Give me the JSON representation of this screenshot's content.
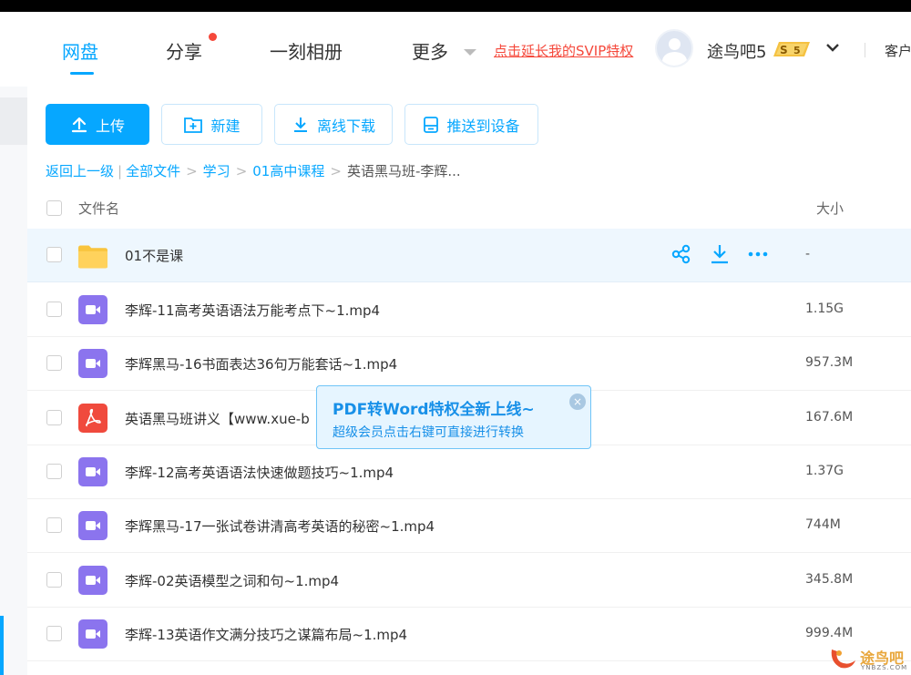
{
  "nav": {
    "items": [
      "网盘",
      "分享",
      "一刻相册",
      "更多"
    ],
    "active_index": 0,
    "svip_link": "点击延长我的SVIP特权",
    "username": "途鸟吧5",
    "svip_level": "5",
    "client_link": "客户端"
  },
  "toolbar": {
    "upload": "上传",
    "new_folder": "新建",
    "offline_download": "离线下载",
    "push_device": "推送到设备"
  },
  "breadcrumb": {
    "back": "返回上一级",
    "items": [
      "全部文件",
      "学习",
      "01高中课程"
    ],
    "current": "英语黑马班-李辉..."
  },
  "list_header": {
    "name": "文件名",
    "size": "大小"
  },
  "files": [
    {
      "name": "01不是课",
      "size": "-",
      "type": "folder"
    },
    {
      "name": "李辉-11高考英语语法万能考点下~1.mp4",
      "size": "1.15G",
      "type": "video"
    },
    {
      "name": "李辉黑马-16书面表达36句万能套话~1.mp4",
      "size": "957.3M",
      "type": "video"
    },
    {
      "name": "英语黑马班讲义【www.xue-b",
      "size": "167.6M",
      "type": "pdf"
    },
    {
      "name": "李辉-12高考英语语法快速做题技巧~1.mp4",
      "size": "1.37G",
      "type": "video"
    },
    {
      "name": "李辉黑马-17一张试卷讲清高考英语的秘密~1.mp4",
      "size": "744M",
      "type": "video"
    },
    {
      "name": "李辉-02英语模型之词和句~1.mp4",
      "size": "345.8M",
      "type": "video"
    },
    {
      "name": "李辉-13英语作文满分技巧之谋篇布局~1.mp4",
      "size": "999.4M",
      "type": "video"
    }
  ],
  "tooltip": {
    "title": "PDF转Word特权全新上线~",
    "subtitle": "超级会员点击右键可直接进行转换",
    "close": "×"
  },
  "watermark": {
    "text": "途鸟吧",
    "sub": "YNBZS.COM"
  },
  "colors": {
    "accent": "#06a7ff",
    "video": "#8b74ee",
    "pdf": "#f04a3d",
    "folder": "#ffcc4d",
    "alert": "#f5483b"
  }
}
